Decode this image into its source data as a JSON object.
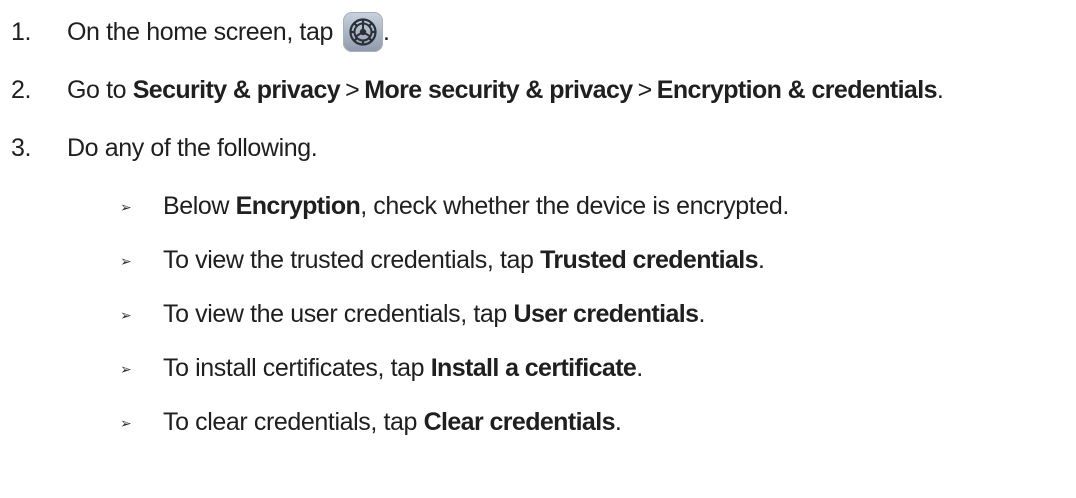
{
  "steps": [
    {
      "number": "1.",
      "before": "On the home screen, tap",
      "after": ".",
      "icon": "settings-gear-icon"
    },
    {
      "number": "2.",
      "prefix": "Go to",
      "path": [
        "Security & privacy",
        "More security & privacy",
        "Encryption & credentials"
      ],
      "separator": ">",
      "suffix": "."
    },
    {
      "number": "3.",
      "text": "Do any of the following."
    }
  ],
  "bullet_symbol": "➢",
  "options": [
    {
      "before": "Below ",
      "bold": "Encryption",
      "after": ", check whether the device is encrypted."
    },
    {
      "before": "To view the trusted credentials, tap ",
      "bold": "Trusted credentials",
      "after": "."
    },
    {
      "before": "To view the user credentials, tap ",
      "bold": "User credentials",
      "after": "."
    },
    {
      "before": "To install certificates, tap ",
      "bold": "Install a certificate",
      "after": "."
    },
    {
      "before": "To clear credentials, tap ",
      "bold": "Clear credentials",
      "after": "."
    }
  ]
}
